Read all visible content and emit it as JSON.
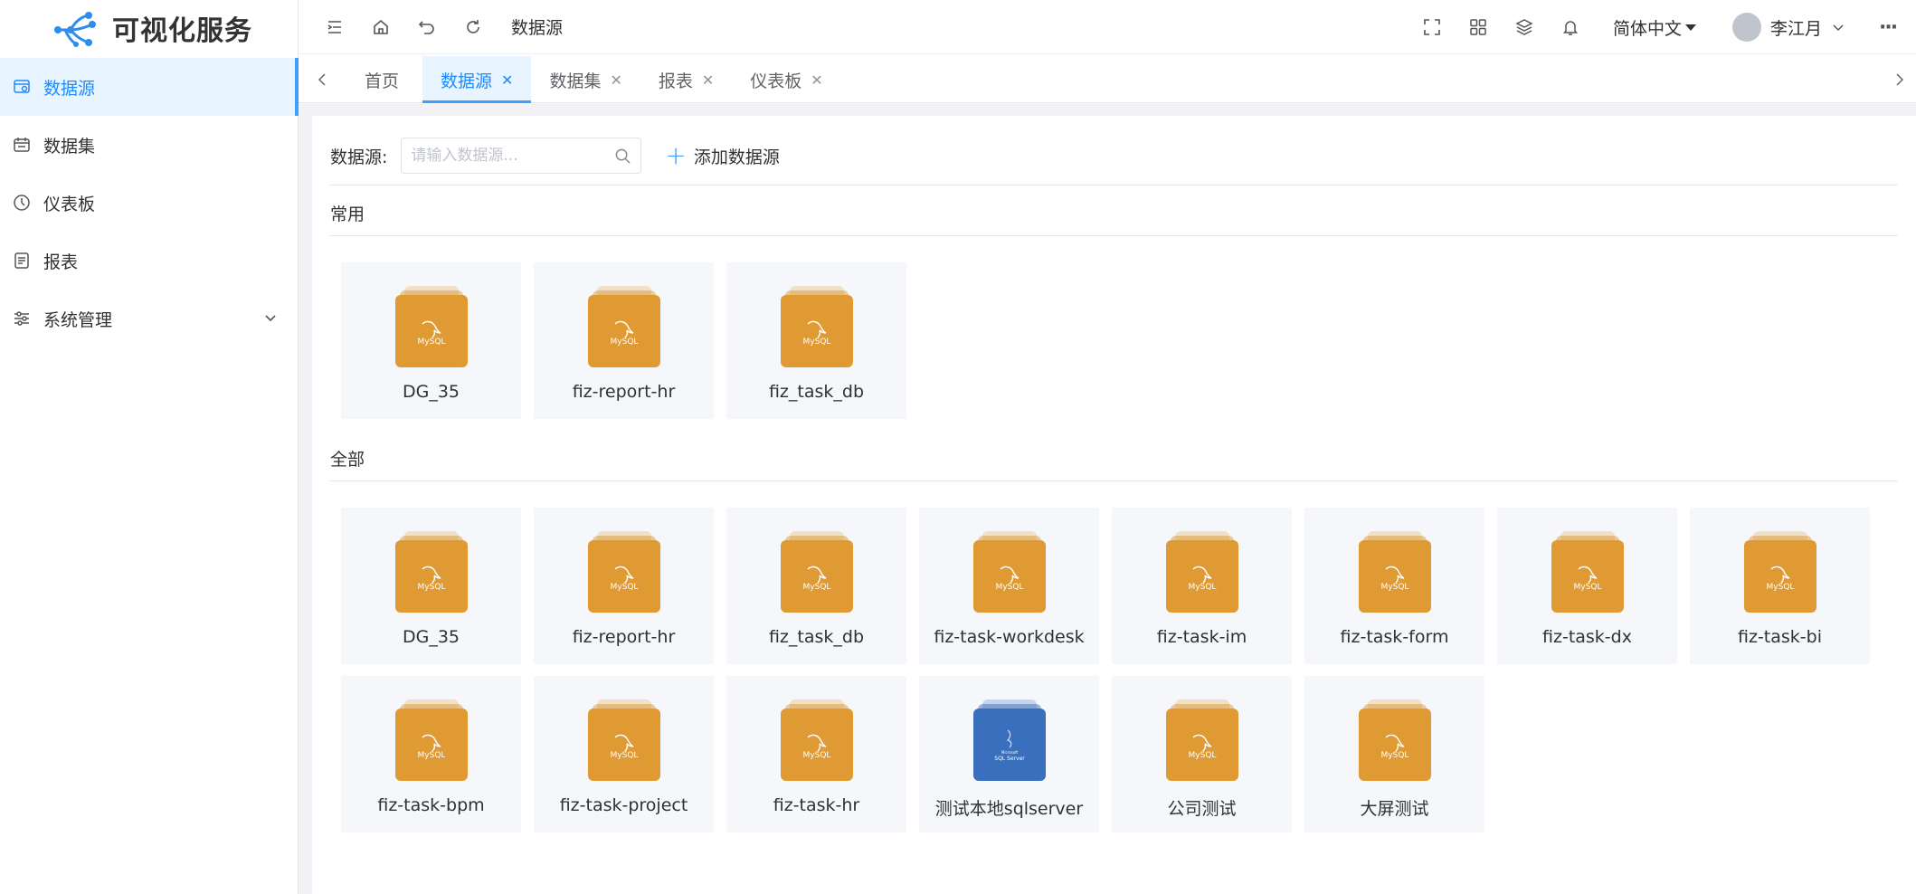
{
  "app": {
    "title": "可视化服务"
  },
  "sidebar": {
    "items": [
      {
        "label": "数据源",
        "icon": "datasource-icon",
        "active": true
      },
      {
        "label": "数据集",
        "icon": "calendar-icon"
      },
      {
        "label": "仪表板",
        "icon": "dashboard-icon"
      },
      {
        "label": "报表",
        "icon": "document-icon"
      },
      {
        "label": "系统管理",
        "icon": "sliders-icon",
        "expandable": true
      }
    ]
  },
  "header": {
    "breadcrumb": "数据源",
    "language": "简体中文",
    "user_name": "李江月",
    "more": "···"
  },
  "tabs": [
    {
      "label": "首页",
      "closable": false
    },
    {
      "label": "数据源",
      "closable": true,
      "active": true
    },
    {
      "label": "数据集",
      "closable": true
    },
    {
      "label": "报表",
      "closable": true
    },
    {
      "label": "仪表板",
      "closable": true
    }
  ],
  "toolbar": {
    "label": "数据源:",
    "search_placeholder": "请输入数据源...",
    "add_label": "添加数据源"
  },
  "sections": {
    "common_title": "常用",
    "all_title": "全部"
  },
  "datasources_common": [
    {
      "name": "DG_35",
      "type": "mysql"
    },
    {
      "name": "fiz-report-hr",
      "type": "mysql"
    },
    {
      "name": "fiz_task_db",
      "type": "mysql"
    }
  ],
  "datasources_all": [
    {
      "name": "DG_35",
      "type": "mysql"
    },
    {
      "name": "fiz-report-hr",
      "type": "mysql"
    },
    {
      "name": "fiz_task_db",
      "type": "mysql"
    },
    {
      "name": "fiz-task-workdesk",
      "type": "mysql"
    },
    {
      "name": "fiz-task-im",
      "type": "mysql"
    },
    {
      "name": "fiz-task-form",
      "type": "mysql"
    },
    {
      "name": "fiz-task-dx",
      "type": "mysql"
    },
    {
      "name": "fiz-task-bi",
      "type": "mysql"
    },
    {
      "name": "fiz-task-bpm",
      "type": "mysql"
    },
    {
      "name": "fiz-task-project",
      "type": "mysql"
    },
    {
      "name": "fiz-task-hr",
      "type": "mysql"
    },
    {
      "name": "测试本地sqlserver",
      "type": "sqlserver"
    },
    {
      "name": "公司测试",
      "type": "mysql"
    },
    {
      "name": "大屏测试",
      "type": "mysql"
    }
  ],
  "icon_text": {
    "mysql": "MySQL",
    "sqlserver_brand": "Microsoft",
    "sqlserver": "SQL Server"
  },
  "colors": {
    "accent": "#409eff",
    "active_bg": "#e8f4ff",
    "mysql": "#e09a33",
    "sqlserver": "#3a6fbd"
  }
}
